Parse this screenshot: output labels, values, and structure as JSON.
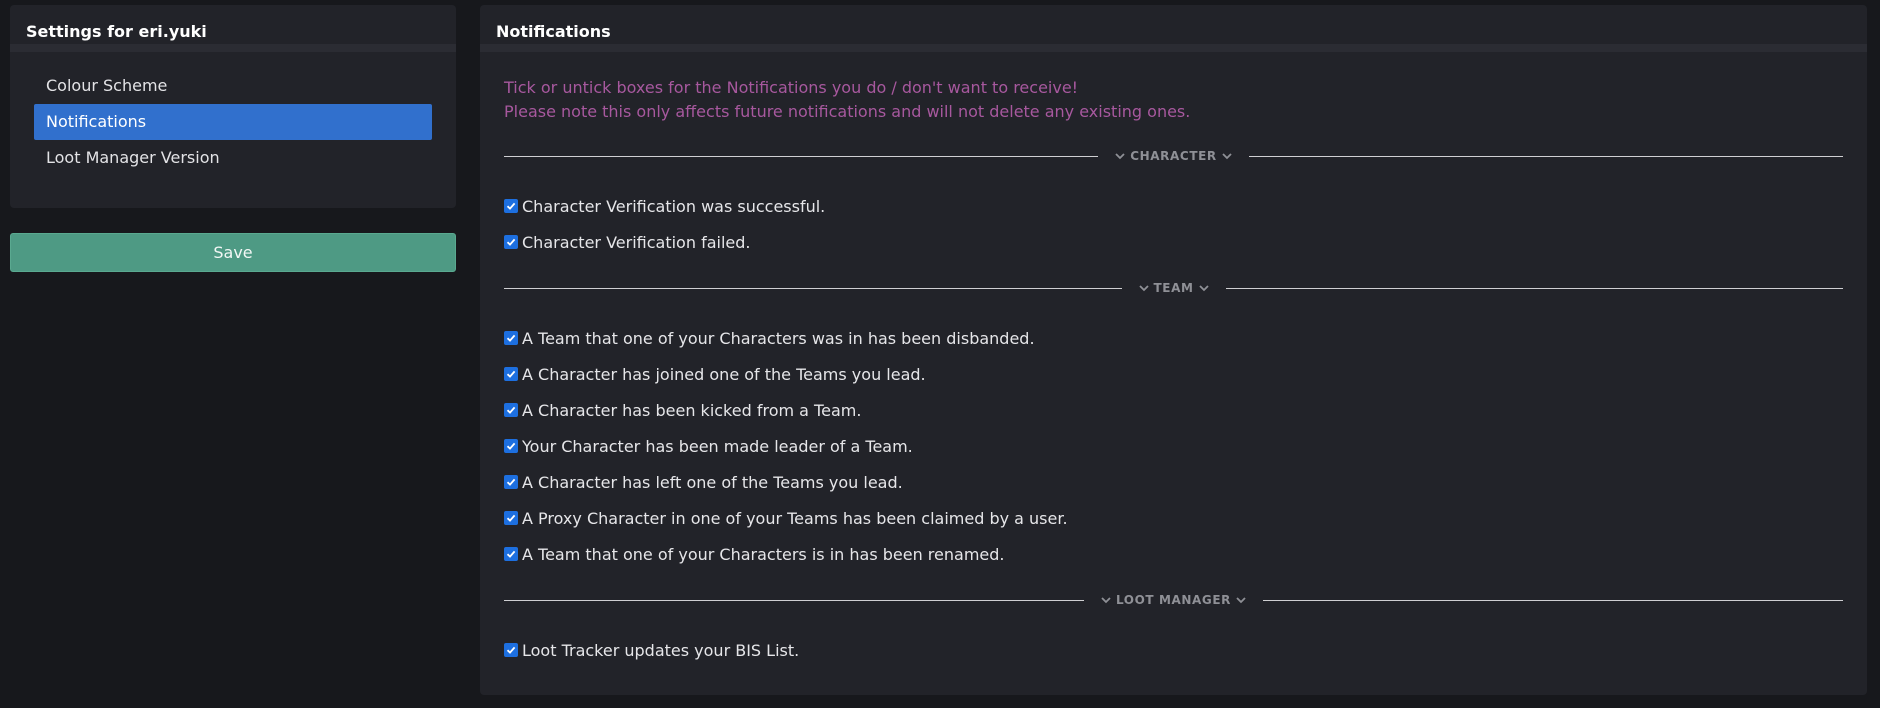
{
  "sidebar": {
    "title": "Settings for eri.yuki",
    "items": [
      {
        "label": "Colour Scheme"
      },
      {
        "label": "Notifications"
      },
      {
        "label": "Loot Manager Version"
      }
    ],
    "active_item": "Notifications",
    "save_label": "Save"
  },
  "main": {
    "title": "Notifications",
    "intro": [
      "Tick or untick boxes for the Notifications you do / don't want to receive!",
      "Please note this only affects future notifications and will not delete any existing ones."
    ],
    "sections": [
      {
        "label": "CHARACTER",
        "options": [
          {
            "label": "Character Verification was successful.",
            "checked": true
          },
          {
            "label": "Character Verification failed.",
            "checked": true
          }
        ]
      },
      {
        "label": "TEAM",
        "options": [
          {
            "label": "A Team that one of your Characters was in has been disbanded.",
            "checked": true
          },
          {
            "label": "A Character has joined one of the Teams you lead.",
            "checked": true
          },
          {
            "label": "A Character has been kicked from a Team.",
            "checked": true
          },
          {
            "label": "Your Character has been made leader of a Team.",
            "checked": true
          },
          {
            "label": "A Character has left one of the Teams you lead.",
            "checked": true
          },
          {
            "label": "A Proxy Character in one of your Teams has been claimed by a user.",
            "checked": true
          },
          {
            "label": "A Team that one of your Characters is in has been renamed.",
            "checked": true
          }
        ]
      },
      {
        "label": "LOOT MANAGER",
        "options": [
          {
            "label": "Loot Tracker updates your BIS List.",
            "checked": true
          }
        ]
      }
    ]
  },
  "colors": {
    "background": "#17181c",
    "card": "#222329",
    "active": "#3170cd",
    "save": "#4e9a84",
    "intro_text": "#a7589e",
    "checkbox": "#1d6fe0"
  },
  "icons": {
    "section_toggle": "chevron-down-icon",
    "checkbox_mark": "checkmark-icon"
  }
}
